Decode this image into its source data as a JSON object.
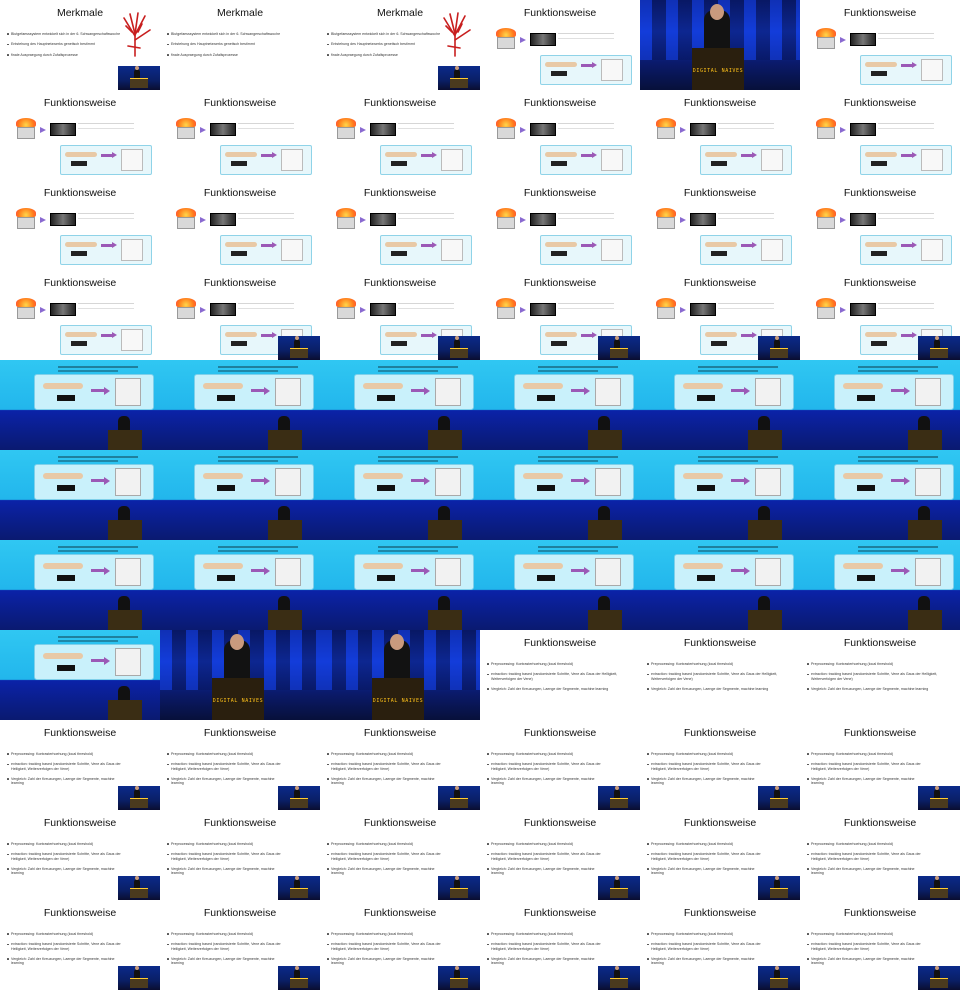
{
  "grid": {
    "columns": 6,
    "rows": 11
  },
  "slides": {
    "merkmale": {
      "title": "Merkmale",
      "bullets": [
        "Blutgefaesssystem entwickelt sich in der 6. Schwangerschaftswoche",
        "Entstehung des Hauptnetzwerks genetisch bestimmt",
        "finale Auspraegung durch Zufallsprozesse"
      ]
    },
    "funktionsweise_diagram": {
      "title": "Funktionsweise"
    },
    "funktionsweise_text": {
      "title": "Funktionsweise",
      "bullets": [
        "Preprocessing: Kontrasterhoehung (local threshold)",
        "extraction: tracking based (randomisierte Schritte, Vene als Gaus der Helligkeit, Weiterverfolgen der Vene)",
        "Vergleich: Zahl der Kreuzungen, Laenge der Segmente, machine learning"
      ]
    },
    "stage": {
      "banner": "DIGITAL NAIVES"
    }
  },
  "frames": [
    "merkmale-hand",
    "merkmale",
    "merkmale-hand",
    "diagram",
    "stage",
    "diagram",
    "diagram",
    "diagram",
    "diagram",
    "diagram",
    "diagram",
    "diagram",
    "diagram",
    "diagram",
    "diagram",
    "diagram",
    "diagram",
    "diagram",
    "diagram",
    "diagram-pip",
    "diagram-pip",
    "diagram-pip",
    "diagram-pip",
    "diagram-pip",
    "zoom",
    "zoom",
    "zoom",
    "zoom",
    "zoom",
    "zoom",
    "zoom",
    "zoom",
    "zoom",
    "zoom",
    "zoom",
    "zoom",
    "zoom",
    "zoom",
    "zoom",
    "zoom",
    "zoom",
    "zoom",
    "zoom",
    "stage",
    "stage",
    "text-full",
    "text-full",
    "text-full",
    "text-pip",
    "text-pip",
    "text-pip",
    "text-pip",
    "text-pip",
    "text-pip",
    "text-pip",
    "text-pip",
    "text-pip",
    "text-pip",
    "text-pip",
    "text-pip",
    "text-pip",
    "text-pip",
    "text-pip",
    "text-pip",
    "text-pip",
    "text-pip"
  ]
}
